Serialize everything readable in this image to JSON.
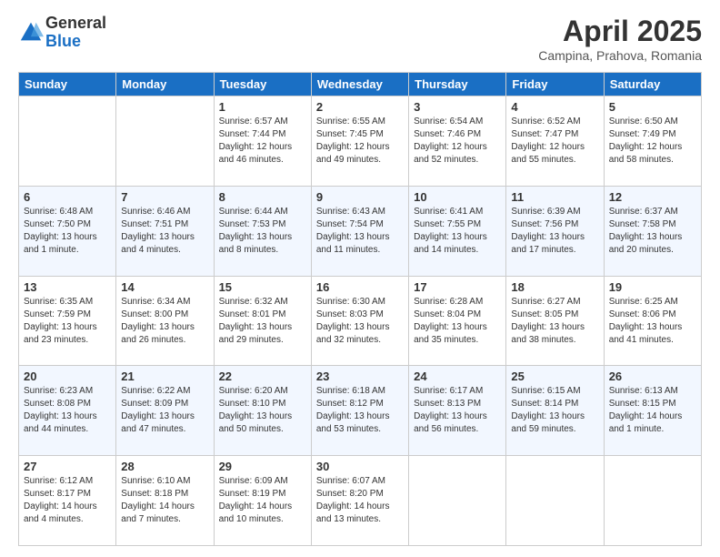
{
  "header": {
    "logo_general": "General",
    "logo_blue": "Blue",
    "month_title": "April 2025",
    "location": "Campina, Prahova, Romania"
  },
  "weekdays": [
    "Sunday",
    "Monday",
    "Tuesday",
    "Wednesday",
    "Thursday",
    "Friday",
    "Saturday"
  ],
  "weeks": [
    [
      {
        "day": "",
        "info": ""
      },
      {
        "day": "",
        "info": ""
      },
      {
        "day": "1",
        "info": "Sunrise: 6:57 AM\nSunset: 7:44 PM\nDaylight: 12 hours and 46 minutes."
      },
      {
        "day": "2",
        "info": "Sunrise: 6:55 AM\nSunset: 7:45 PM\nDaylight: 12 hours and 49 minutes."
      },
      {
        "day": "3",
        "info": "Sunrise: 6:54 AM\nSunset: 7:46 PM\nDaylight: 12 hours and 52 minutes."
      },
      {
        "day": "4",
        "info": "Sunrise: 6:52 AM\nSunset: 7:47 PM\nDaylight: 12 hours and 55 minutes."
      },
      {
        "day": "5",
        "info": "Sunrise: 6:50 AM\nSunset: 7:49 PM\nDaylight: 12 hours and 58 minutes."
      }
    ],
    [
      {
        "day": "6",
        "info": "Sunrise: 6:48 AM\nSunset: 7:50 PM\nDaylight: 13 hours and 1 minute."
      },
      {
        "day": "7",
        "info": "Sunrise: 6:46 AM\nSunset: 7:51 PM\nDaylight: 13 hours and 4 minutes."
      },
      {
        "day": "8",
        "info": "Sunrise: 6:44 AM\nSunset: 7:53 PM\nDaylight: 13 hours and 8 minutes."
      },
      {
        "day": "9",
        "info": "Sunrise: 6:43 AM\nSunset: 7:54 PM\nDaylight: 13 hours and 11 minutes."
      },
      {
        "day": "10",
        "info": "Sunrise: 6:41 AM\nSunset: 7:55 PM\nDaylight: 13 hours and 14 minutes."
      },
      {
        "day": "11",
        "info": "Sunrise: 6:39 AM\nSunset: 7:56 PM\nDaylight: 13 hours and 17 minutes."
      },
      {
        "day": "12",
        "info": "Sunrise: 6:37 AM\nSunset: 7:58 PM\nDaylight: 13 hours and 20 minutes."
      }
    ],
    [
      {
        "day": "13",
        "info": "Sunrise: 6:35 AM\nSunset: 7:59 PM\nDaylight: 13 hours and 23 minutes."
      },
      {
        "day": "14",
        "info": "Sunrise: 6:34 AM\nSunset: 8:00 PM\nDaylight: 13 hours and 26 minutes."
      },
      {
        "day": "15",
        "info": "Sunrise: 6:32 AM\nSunset: 8:01 PM\nDaylight: 13 hours and 29 minutes."
      },
      {
        "day": "16",
        "info": "Sunrise: 6:30 AM\nSunset: 8:03 PM\nDaylight: 13 hours and 32 minutes."
      },
      {
        "day": "17",
        "info": "Sunrise: 6:28 AM\nSunset: 8:04 PM\nDaylight: 13 hours and 35 minutes."
      },
      {
        "day": "18",
        "info": "Sunrise: 6:27 AM\nSunset: 8:05 PM\nDaylight: 13 hours and 38 minutes."
      },
      {
        "day": "19",
        "info": "Sunrise: 6:25 AM\nSunset: 8:06 PM\nDaylight: 13 hours and 41 minutes."
      }
    ],
    [
      {
        "day": "20",
        "info": "Sunrise: 6:23 AM\nSunset: 8:08 PM\nDaylight: 13 hours and 44 minutes."
      },
      {
        "day": "21",
        "info": "Sunrise: 6:22 AM\nSunset: 8:09 PM\nDaylight: 13 hours and 47 minutes."
      },
      {
        "day": "22",
        "info": "Sunrise: 6:20 AM\nSunset: 8:10 PM\nDaylight: 13 hours and 50 minutes."
      },
      {
        "day": "23",
        "info": "Sunrise: 6:18 AM\nSunset: 8:12 PM\nDaylight: 13 hours and 53 minutes."
      },
      {
        "day": "24",
        "info": "Sunrise: 6:17 AM\nSunset: 8:13 PM\nDaylight: 13 hours and 56 minutes."
      },
      {
        "day": "25",
        "info": "Sunrise: 6:15 AM\nSunset: 8:14 PM\nDaylight: 13 hours and 59 minutes."
      },
      {
        "day": "26",
        "info": "Sunrise: 6:13 AM\nSunset: 8:15 PM\nDaylight: 14 hours and 1 minute."
      }
    ],
    [
      {
        "day": "27",
        "info": "Sunrise: 6:12 AM\nSunset: 8:17 PM\nDaylight: 14 hours and 4 minutes."
      },
      {
        "day": "28",
        "info": "Sunrise: 6:10 AM\nSunset: 8:18 PM\nDaylight: 14 hours and 7 minutes."
      },
      {
        "day": "29",
        "info": "Sunrise: 6:09 AM\nSunset: 8:19 PM\nDaylight: 14 hours and 10 minutes."
      },
      {
        "day": "30",
        "info": "Sunrise: 6:07 AM\nSunset: 8:20 PM\nDaylight: 14 hours and 13 minutes."
      },
      {
        "day": "",
        "info": ""
      },
      {
        "day": "",
        "info": ""
      },
      {
        "day": "",
        "info": ""
      }
    ]
  ]
}
